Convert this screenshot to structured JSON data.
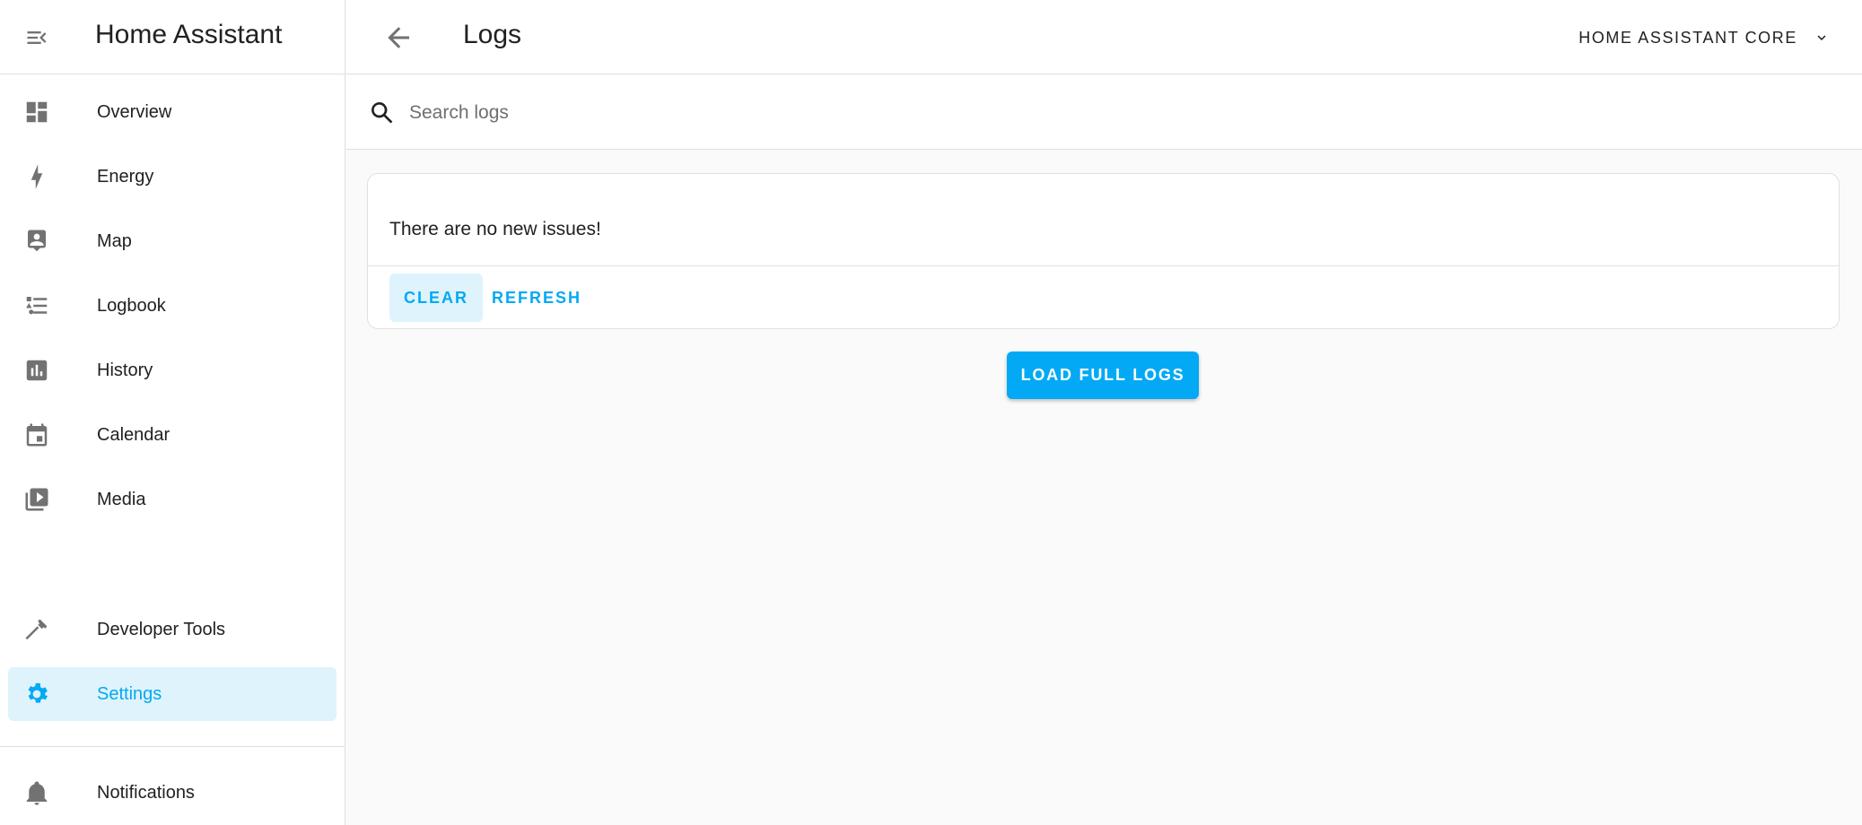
{
  "app": {
    "title": "Home Assistant",
    "menu_icon": "menu-collapse-icon"
  },
  "sidebar": {
    "items": [
      {
        "label": "Overview",
        "icon": "dashboard-icon"
      },
      {
        "label": "Energy",
        "icon": "lightning-bolt-icon"
      },
      {
        "label": "Map",
        "icon": "account-location-icon"
      },
      {
        "label": "Logbook",
        "icon": "format-list-bulleted-type-icon"
      },
      {
        "label": "History",
        "icon": "chart-box-icon"
      },
      {
        "label": "Calendar",
        "icon": "calendar-icon"
      },
      {
        "label": "Media",
        "icon": "play-box-multiple-icon"
      }
    ],
    "bottom_items": [
      {
        "label": "Developer Tools",
        "icon": "hammer-icon"
      },
      {
        "label": "Settings",
        "icon": "cog-icon",
        "active": true
      }
    ],
    "notifications": {
      "label": "Notifications",
      "icon": "bell-icon"
    }
  },
  "header": {
    "back_icon": "arrow-left-icon",
    "title": "Logs",
    "source_select": {
      "selected": "HOME ASSISTANT CORE",
      "icon": "chevron-down-icon"
    }
  },
  "search": {
    "placeholder": "Search logs",
    "value": ""
  },
  "card": {
    "message": "There are no new issues!",
    "actions": {
      "clear": "CLEAR",
      "refresh": "REFRESH"
    }
  },
  "load_full_logs": "LOAD FULL LOGS",
  "colors": {
    "accent": "#03a9f4",
    "active_bg": "#dff3fc",
    "icon_gray": "#727272",
    "page_bg": "#fafafa"
  }
}
